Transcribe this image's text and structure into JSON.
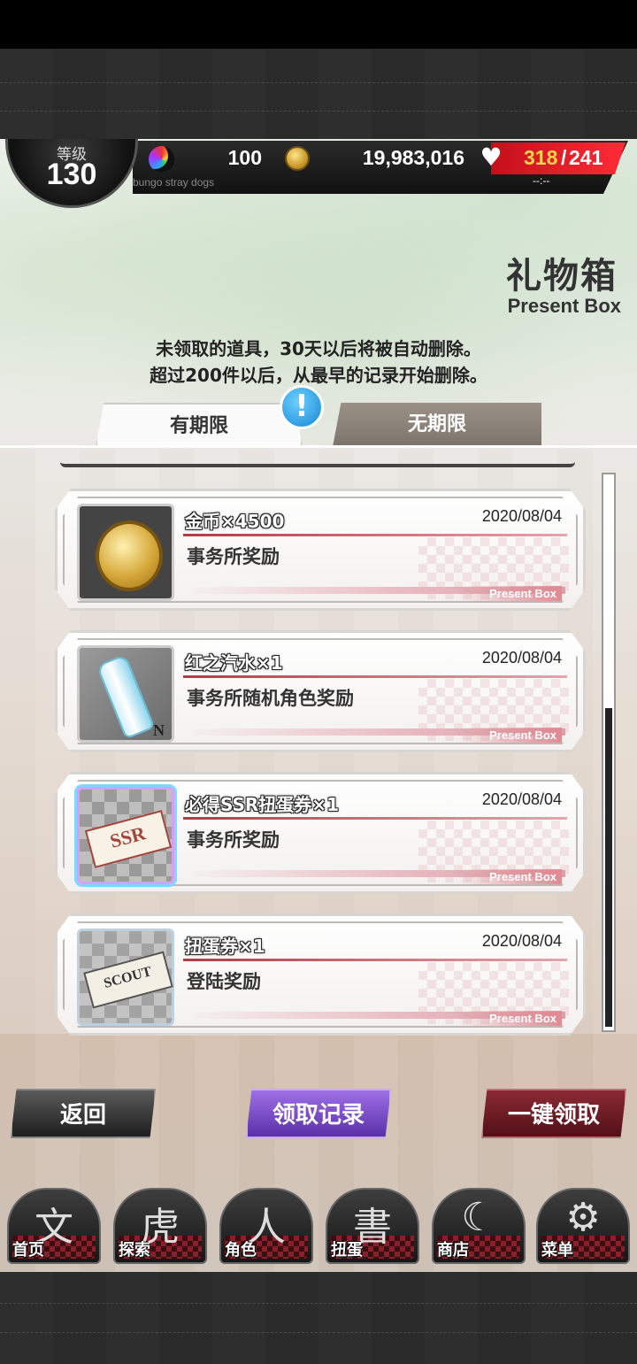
{
  "status": {
    "level_label": "等级",
    "level": "130",
    "subtitle": "bungo stray dogs",
    "gems": "100",
    "coins": "19,983,016",
    "stamina_current": "318",
    "stamina_sep": "/",
    "stamina_max": "241",
    "stamina_timer": "--:--",
    "icons": {
      "gem": "rainbow-crescent-icon",
      "coin": "gold-coin-icon",
      "stamina": "heart-icon"
    }
  },
  "header": {
    "title_cn": "礼物箱",
    "title_en": "Present Box",
    "notice_line1": "未领取的道具，30天以后将被自动删除。",
    "notice_line2": "超过200件以后，从最早的记录开始删除。"
  },
  "tabs": [
    {
      "label": "有期限",
      "active": true
    },
    {
      "label": "无期限",
      "active": false
    }
  ],
  "alert_badge": "!",
  "items": [
    {
      "name": "金币×4500",
      "date": "2020/08/04",
      "desc": "事务所奖励",
      "footer": "Present Box",
      "icon": "gold-coin-icon"
    },
    {
      "name": "红之汽水×1",
      "date": "2020/08/04",
      "desc": "事务所随机角色奖励",
      "footer": "Present Box",
      "icon": "soda-bottle-icon",
      "rarity": "N"
    },
    {
      "name": "必得SSR扭蛋券×1",
      "date": "2020/08/04",
      "desc": "事务所奖励",
      "footer": "Present Box",
      "icon": "ssr-ticket-icon"
    },
    {
      "name": "扭蛋券×1",
      "date": "2020/08/04",
      "desc": "登陆奖励",
      "footer": "Present Box",
      "icon": "scout-ticket-icon"
    }
  ],
  "actions": {
    "back": "返回",
    "history": "领取记录",
    "claim_all": "一键领取"
  },
  "nav": [
    {
      "label": "首页",
      "icon": "home-icon",
      "glyph": "文"
    },
    {
      "label": "探索",
      "icon": "tiger-icon",
      "glyph": "虎"
    },
    {
      "label": "角色",
      "icon": "characters-icon",
      "glyph": "人"
    },
    {
      "label": "扭蛋",
      "icon": "gacha-book-icon",
      "glyph": "書"
    },
    {
      "label": "商店",
      "icon": "shop-crescent-icon",
      "glyph": "☾"
    },
    {
      "label": "菜单",
      "icon": "gear-icon",
      "glyph": "⚙"
    }
  ]
}
